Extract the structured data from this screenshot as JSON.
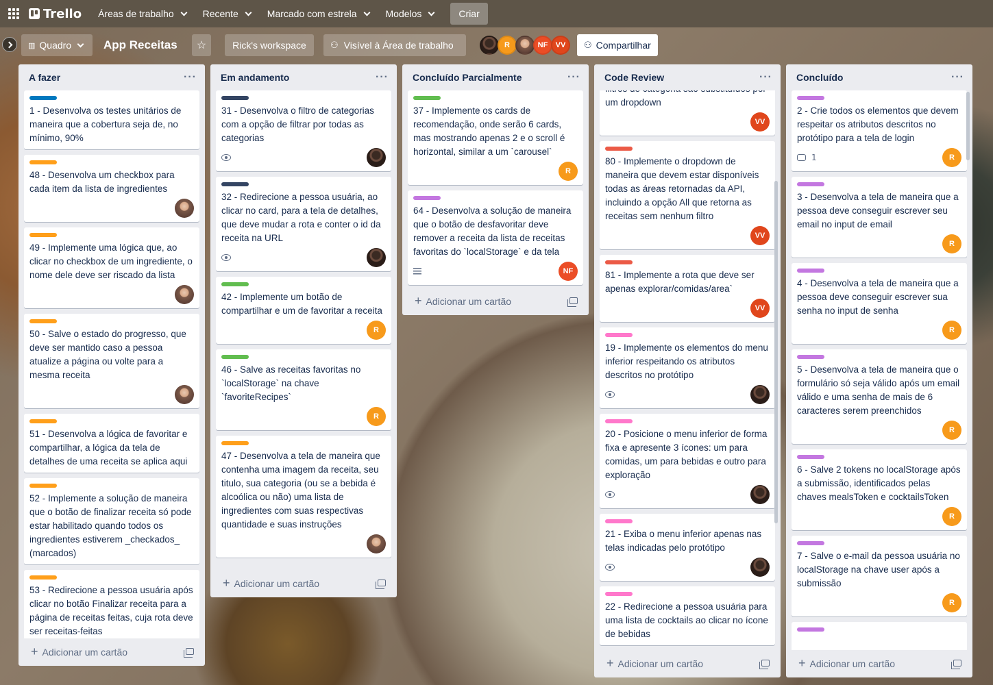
{
  "topbar": {
    "brand": "Trello",
    "nav": [
      "Áreas de trabalho",
      "Recente",
      "Marcado com estrela",
      "Modelos"
    ],
    "create": "Criar"
  },
  "board": {
    "view": "Quadro",
    "title": "App Receitas",
    "workspace": "Rick's workspace",
    "visibility": "Visível à Área de trabalho",
    "share": "Compartilhar",
    "members": [
      {
        "initials": "",
        "color": "#3a2a22",
        "kind": "photo"
      },
      {
        "initials": "R",
        "color": "#f79a1b",
        "kind": "initials"
      },
      {
        "initials": "",
        "color": "#7a5848",
        "kind": "photo2"
      },
      {
        "initials": "NF",
        "color": "#eb4d26",
        "kind": "initials"
      },
      {
        "initials": "VV",
        "color": "#e0461c",
        "kind": "initials"
      }
    ]
  },
  "colors": {
    "blue": "#0079bf",
    "orange": "#ff9f1a",
    "navy": "#344563",
    "green": "#61bd4f",
    "purple": "#c377e0",
    "red": "#eb5a46",
    "pink": "#ff78cb",
    "avatar_r": "#f79a1b",
    "avatar_nf": "#eb4d26",
    "avatar_vv": "#e0461c"
  },
  "add_card_label": "Adicionar um cartão",
  "lists": [
    {
      "title": "A fazer",
      "cards": [
        {
          "label": "blue",
          "text": "1 - Desenvolva os testes unitários de maneira que a cobertura seja de, no mínimo, 90%"
        },
        {
          "label": "orange",
          "text": "48 - Desenvolva um checkbox para cada item da lista de ingredientes",
          "member": "photo2"
        },
        {
          "label": "orange",
          "text": "49 - Implemente uma lógica que, ao clicar no checkbox de um ingrediente, o nome dele deve ser riscado da lista",
          "member": "photo2"
        },
        {
          "label": "orange",
          "text": "50 - Salve o estado do progresso, que deve ser mantido caso a pessoa atualize a página ou volte para a mesma receita",
          "member": "photo2"
        },
        {
          "label": "orange",
          "text": "51 - Desenvolva a lógica de favoritar e compartilhar, a lógica da tela de detalhes de uma receita se aplica aqui"
        },
        {
          "label": "orange",
          "text": "52 - Implemente a solução de maneira que o botão de finalizar receita só pode estar habilitado quando todos os ingredientes estiverem _checkados_ (marcados)"
        },
        {
          "label": "orange",
          "text": "53 - Redirecione a pessoa usuária após clicar no botão Finalizar receita para a página de receitas feitas, cuja rota deve ser receitas-feitas"
        }
      ]
    },
    {
      "title": "Em andamento",
      "cards": [
        {
          "label": "navy",
          "text": "31 - Desenvolva o filtro de categorias com a opção de filtrar por todas as categorias",
          "watch": true,
          "member": "photo"
        },
        {
          "label": "navy",
          "text": "32 - Redirecione a pessoa usuária, ao clicar no card, para a tela de detalhes, que deve mudar a rota e conter o id da receita na URL",
          "watch": true,
          "member": "photo"
        },
        {
          "label": "green",
          "text": "42 - Implemente um botão de compartilhar e um de favoritar a receita",
          "member": "R"
        },
        {
          "label": "green",
          "text": "46 - Salve as receitas favoritas no `localStorage` na chave `favoriteRecipes`",
          "member": "R"
        },
        {
          "label": "orange",
          "text": "47 - Desenvolva a tela de maneira que contenha uma imagem da receita, seu titulo, sua categoria (ou se a bebida é alcoólica ou não) uma lista de ingredientes com suas respectivas quantidade e suas instruções",
          "member": "photo2"
        }
      ]
    },
    {
      "title": "Concluído Parcialmente",
      "cards": [
        {
          "label": "green",
          "text": "37 - Implemente os cards de recomendação, onde serão 6 cards, mas mostrando apenas 2 e o scroll é horizontal, similar a um `carousel`",
          "member": "R"
        },
        {
          "label": "purple",
          "text": "64 - Desenvolva a solução de maneira que o botão de desfavoritar deve remover a receita da lista de receitas favoritas do `localStorage` e da tela",
          "desc": true,
          "member": "NF"
        }
      ]
    },
    {
      "title": "Code Review",
      "cards": [
        {
          "label": "",
          "text": "filtros de categoria são substituídos por um dropdown",
          "member": "VV"
        },
        {
          "label": "red",
          "text": "80 - Implemente o dropdown de maneira que devem estar disponíveis todas as áreas retornadas da API, incluindo a opção All que retorna as receitas sem nenhum filtro",
          "member": "VV"
        },
        {
          "label": "red",
          "text": "81 - Implemente a rota que deve ser apenas explorar/comidas/area`",
          "member": "VV"
        },
        {
          "label": "pink",
          "text": "19 - Implemente os elementos do menu inferior respeitando os atributos descritos no protótipo",
          "watch": true,
          "member": "photo"
        },
        {
          "label": "pink",
          "text": "20 - Posicione o menu inferior de forma fixa e apresente 3 ícones: um para comidas, um para bebidas e outro para exploração",
          "watch": true,
          "member": "photo"
        },
        {
          "label": "pink",
          "text": "21 - Exiba o menu inferior apenas nas telas indicadas pelo protótipo",
          "watch": true,
          "member": "photo"
        },
        {
          "label": "pink",
          "text": "22 - Redirecione a pessoa usuária para uma lista de cocktails ao clicar no ícone de bebidas"
        }
      ]
    },
    {
      "title": "Concluído",
      "cards": [
        {
          "label": "purple",
          "text": "2 - Crie todos os elementos que devem respeitar os atributos descritos no protótipo para a tela de login",
          "comments": "1",
          "member": "R"
        },
        {
          "label": "purple",
          "text": "3 - Desenvolva a tela de maneira que a pessoa deve conseguir escrever seu email no input de email",
          "member": "R"
        },
        {
          "label": "purple",
          "text": "4 - Desenvolva a tela de maneira que a pessoa deve conseguir escrever sua senha no input de senha",
          "member": "R"
        },
        {
          "label": "purple",
          "text": "5 - Desenvolva a tela de maneira que o formulário só seja válido após um email válido e uma senha de mais de 6 caracteres serem preenchidos",
          "member": "R"
        },
        {
          "label": "purple",
          "text": "6 - Salve 2 tokens no localStorage após a submissão, identificados pelas chaves mealsToken e cocktailsToken",
          "member": "R"
        },
        {
          "label": "purple",
          "text": "7 - Salve o e-mail da pessoa usuária no localStorage na chave user após a submissão",
          "member": "R"
        },
        {
          "label": "purple",
          "text": ""
        }
      ]
    }
  ]
}
